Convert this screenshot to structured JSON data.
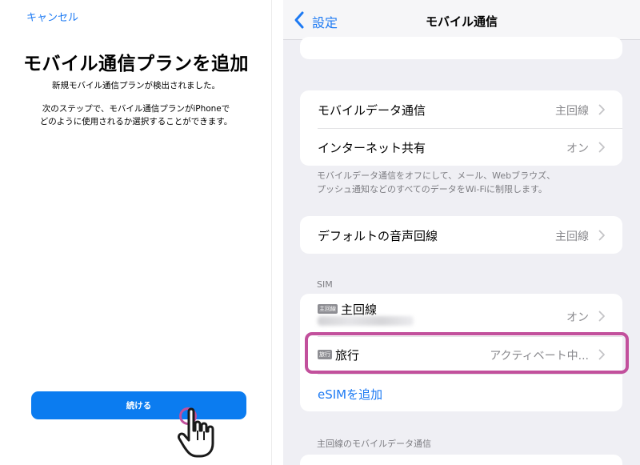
{
  "left": {
    "cancel_label": "キャンセル",
    "title": "モバイル通信プランを追加",
    "detected_text": "新規モバイル通信プランが検出されました。",
    "next_line1": "次のステップで、モバイル通信プランがiPhoneで",
    "next_line2": "どのように使用されるか選択することができます。",
    "continue_label": "続ける"
  },
  "right": {
    "back_label": "設定",
    "nav_title": "モバイル通信",
    "mobile_data": {
      "label": "モバイルデータ通信",
      "value": "主回線"
    },
    "hotspot": {
      "label": "インターネット共有",
      "value": "オン"
    },
    "note_line1": "モバイルデータ通信をオフにして、メール、Webブラウズ、",
    "note_line2": "プッシュ通知などのすべてのデータをWi-Fiに制限します。",
    "default_voice": {
      "label": "デフォルトの音声回線",
      "value": "主回線"
    },
    "sim_header": "SIM",
    "primary_line": {
      "badge": "主回線",
      "label": "主回線",
      "value": "オン"
    },
    "travel_line": {
      "badge": "旅行",
      "label": "旅行",
      "value": "アクティベート中..."
    },
    "add_esim_label": "eSIMを追加",
    "primary_data_header": "主回線のモバイルデータ通信"
  },
  "colors": {
    "accent": "#1d7af3",
    "button": "#0b7cf0",
    "highlight": "#c2509c",
    "grouped_background": "#efeff4"
  },
  "icons": {
    "back": "chevron-left-icon",
    "row_disclosure": "chevron-right-icon",
    "tap": "hand-pointer-icon"
  }
}
